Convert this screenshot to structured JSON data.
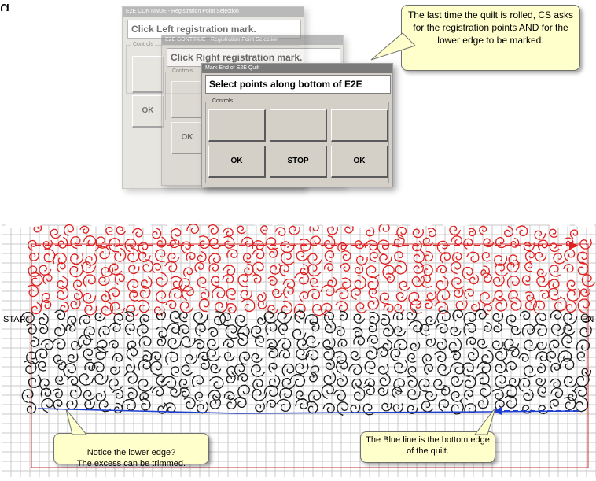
{
  "heading_fragment": "g",
  "dialogs": {
    "left": {
      "title": "E2E CONTINUE - Registration Point Selection",
      "prompt": "Click Left registration mark.",
      "controls_label": "Controls",
      "ok_label": "OK"
    },
    "right": {
      "title": "E2E CONTINUE - Registration Point Selection",
      "prompt": "Click Right registration mark.",
      "controls_label": "Controls",
      "ok_label": "OK"
    },
    "end": {
      "title": "Mark End of E2E Quilt",
      "prompt": "Select points along bottom of E2E",
      "controls_label": "Controls",
      "buttons": [
        "OK",
        "STOP",
        "OK"
      ]
    }
  },
  "callouts": {
    "top": "The last time the quilt is rolled, CS asks for the registration points AND for the lower edge to be marked.",
    "lower_edge": "Notice the lower edge?\nThe excess can be trimmed.",
    "blue_line": "The Blue line is the bottom edge of the quilt."
  },
  "quilt": {
    "start_label": "START",
    "end_label": "EN",
    "colors": {
      "grid": "#c8c8c8",
      "red_pattern": "#e02020",
      "black_pattern": "#1a1a1a",
      "blue_line": "#1f3fd0",
      "border": "#cc3333"
    }
  }
}
